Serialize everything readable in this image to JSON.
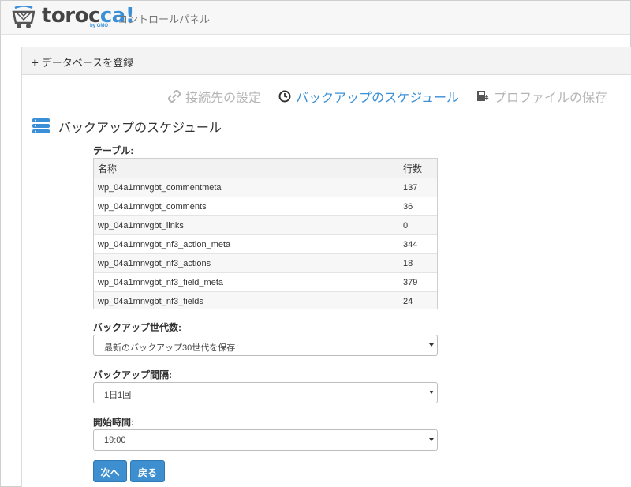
{
  "header": {
    "logo_main": "toroc",
    "logo_accent": "ca!",
    "logo_sub": "by GMO",
    "app_title": "コントロールパネル"
  },
  "panel": {
    "title": "データベースを登録"
  },
  "steps": [
    {
      "label": "接続先の設定",
      "icon": "link-icon",
      "active": false
    },
    {
      "label": "バックアップのスケジュール",
      "icon": "clock-icon",
      "active": true
    },
    {
      "label": "プロファイルの保存",
      "icon": "save-icon",
      "active": false
    }
  ],
  "section": {
    "title": "バックアップのスケジュール",
    "icon": "database-icon"
  },
  "table": {
    "label": "テーブル:",
    "columns": [
      "名称",
      "行数"
    ],
    "rows": [
      [
        "wp_04a1mnvgbt_commentmeta",
        "137"
      ],
      [
        "wp_04a1mnvgbt_comments",
        "36"
      ],
      [
        "wp_04a1mnvgbt_links",
        "0"
      ],
      [
        "wp_04a1mnvgbt_nf3_action_meta",
        "344"
      ],
      [
        "wp_04a1mnvgbt_nf3_actions",
        "18"
      ],
      [
        "wp_04a1mnvgbt_nf3_field_meta",
        "379"
      ],
      [
        "wp_04a1mnvgbt_nf3_fields",
        "24"
      ]
    ]
  },
  "form": {
    "generations_label": "バックアップ世代数:",
    "generations_value": "最新のバックアップ30世代を保存",
    "interval_label": "バックアップ間隔:",
    "interval_value": "1日1回",
    "start_label": "開始時間:",
    "start_value": "19:00"
  },
  "buttons": {
    "next": "次へ",
    "back": "戻る"
  },
  "colors": {
    "accent": "#3a8fd6",
    "button": "#3d8fcf",
    "inactive_step": "#b5b5b5"
  }
}
